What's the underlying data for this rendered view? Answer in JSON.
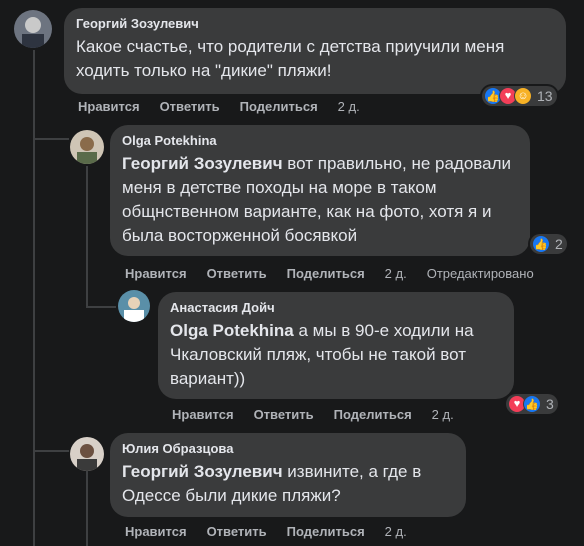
{
  "comments": [
    {
      "author": "Георгий Зозулевич",
      "mention": "",
      "text": "Какое счастье, что родители с детства приучили меня ходить только на \"дикие\" пляжи!",
      "actions": [
        "Нравится",
        "Ответить",
        "Поделиться"
      ],
      "time": "2 д.",
      "reactions": [
        "like",
        "love",
        "care"
      ],
      "reaction_count": "13"
    },
    {
      "author": "Olga Potekhina",
      "mention": "Георгий Зозулевич",
      "text": " вот правильно, не радовали меня в детстве походы на море в таком общнственном варианте, как на фото, хотя я и была восторженной босявкой",
      "actions": [
        "Нравится",
        "Ответить",
        "Поделиться"
      ],
      "time": "2 д.",
      "edited": "Отредактировано",
      "reactions": [
        "like"
      ],
      "reaction_count": "2"
    },
    {
      "author": "Анастасия Дойч",
      "mention": "Olga Potekhina",
      "text": " а мы в 90-е ходили на Чкаловский пляж, чтобы не такой вот вариант))",
      "actions": [
        "Нравится",
        "Ответить",
        "Поделиться"
      ],
      "time": "2 д.",
      "reactions": [
        "love",
        "like"
      ],
      "reaction_count": "3"
    },
    {
      "author": "Юлия Образцова",
      "mention": "Георгий Зозулевич",
      "text": " извините, а где в Одессе были дикие пляжи?",
      "actions": [
        "Нравится",
        "Ответить",
        "Поделиться"
      ],
      "time": "2 д."
    }
  ],
  "colors": {
    "background": "#18191a",
    "bubble": "#3a3b3c",
    "text": "#e4e6eb",
    "secondary": "#b0b3b8",
    "like": "#1877f2",
    "love": "#f33e58",
    "care": "#f7b125"
  },
  "icons": {
    "like": "like-icon",
    "love": "love-icon",
    "care": "care-icon"
  }
}
